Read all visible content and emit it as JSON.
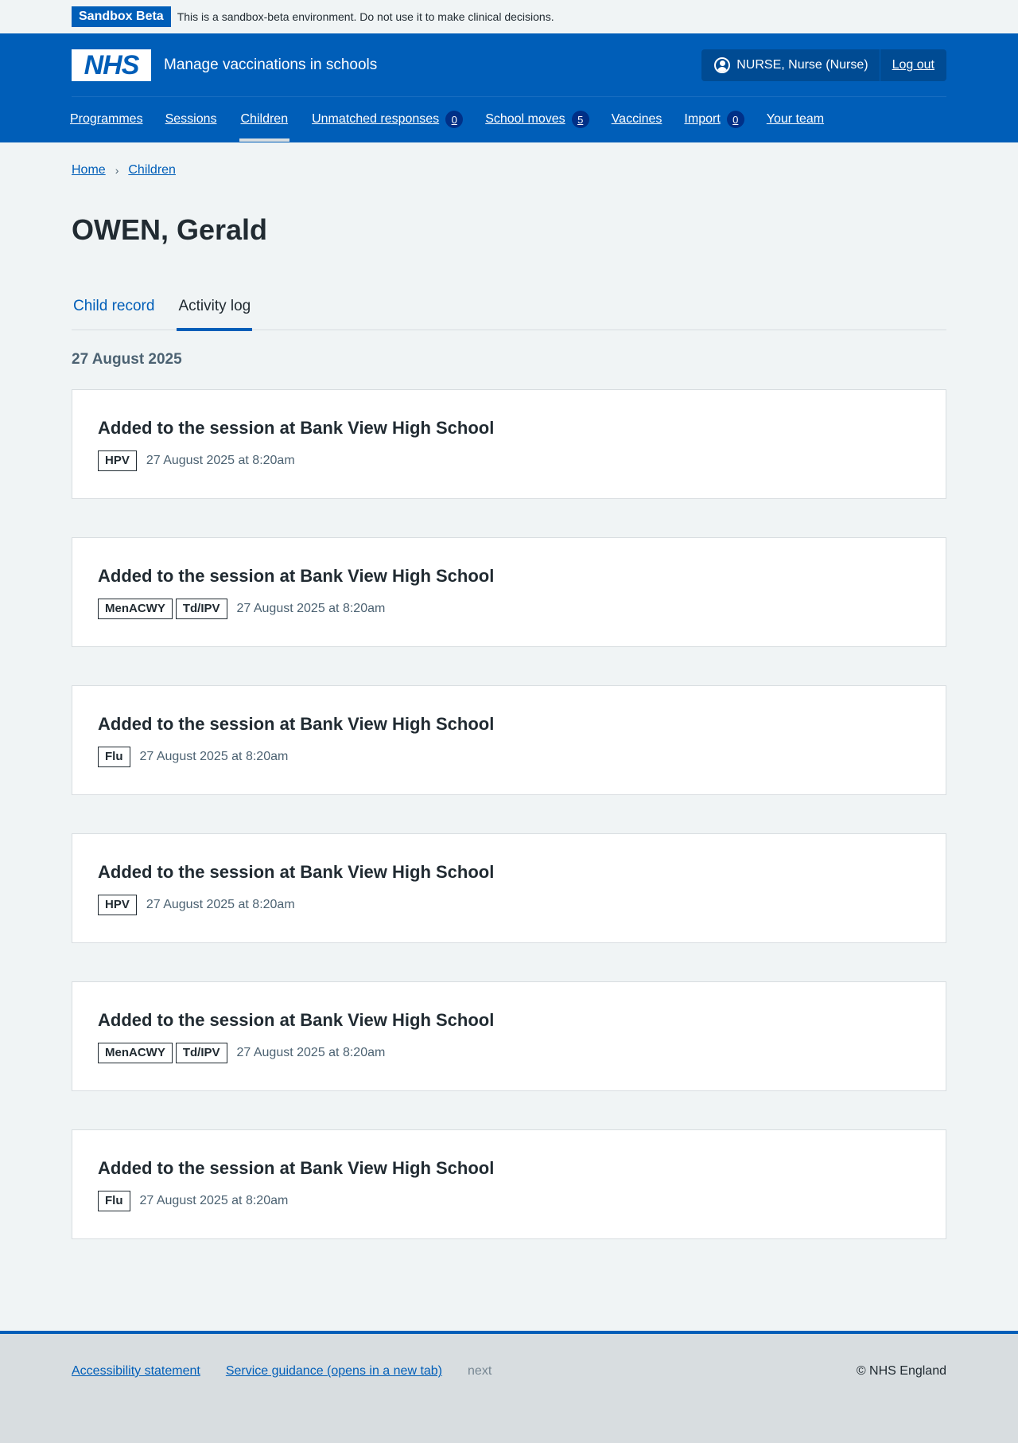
{
  "sandbox": {
    "tag": "Sandbox Beta",
    "message": "This is a sandbox-beta environment. Do not use it to make clinical decisions."
  },
  "header": {
    "logo_text": "NHS",
    "service_name": "Manage vaccinations in schools",
    "user": "NURSE, Nurse (Nurse)",
    "logout": "Log out"
  },
  "nav": {
    "items": [
      {
        "label": "Programmes"
      },
      {
        "label": "Sessions"
      },
      {
        "label": "Children"
      },
      {
        "label": "Unmatched responses",
        "count": "0"
      },
      {
        "label": "School moves",
        "count": "5"
      },
      {
        "label": "Vaccines"
      },
      {
        "label": "Import",
        "count": "0"
      },
      {
        "label": "Your team"
      }
    ]
  },
  "breadcrumb": {
    "home": "Home",
    "children": "Children"
  },
  "page_title": "OWEN, Gerald",
  "tabs": {
    "child_record": "Child record",
    "activity_log": "Activity log"
  },
  "date_heading": "27 August 2025",
  "events": [
    {
      "title": "Added to the session at Bank View High School",
      "tags": [
        "HPV"
      ],
      "time": "27 August 2025 at 8:20am"
    },
    {
      "title": "Added to the session at Bank View High School",
      "tags": [
        "MenACWY",
        "Td/IPV"
      ],
      "time": "27 August 2025 at 8:20am"
    },
    {
      "title": "Added to the session at Bank View High School",
      "tags": [
        "Flu"
      ],
      "time": "27 August 2025 at 8:20am"
    },
    {
      "title": "Added to the session at Bank View High School",
      "tags": [
        "HPV"
      ],
      "time": "27 August 2025 at 8:20am"
    },
    {
      "title": "Added to the session at Bank View High School",
      "tags": [
        "MenACWY",
        "Td/IPV"
      ],
      "time": "27 August 2025 at 8:20am"
    },
    {
      "title": "Added to the session at Bank View High School",
      "tags": [
        "Flu"
      ],
      "time": "27 August 2025 at 8:20am"
    }
  ],
  "footer": {
    "accessibility": "Accessibility statement",
    "guidance": "Service guidance (opens in a new tab)",
    "next": "next",
    "copyright": "© NHS England"
  },
  "colors": {
    "nhs_blue": "#005eb8",
    "dark_blue": "#004b93",
    "page_bg": "#f0f4f5",
    "text": "#212b32",
    "secondary_text": "#4c6272"
  }
}
